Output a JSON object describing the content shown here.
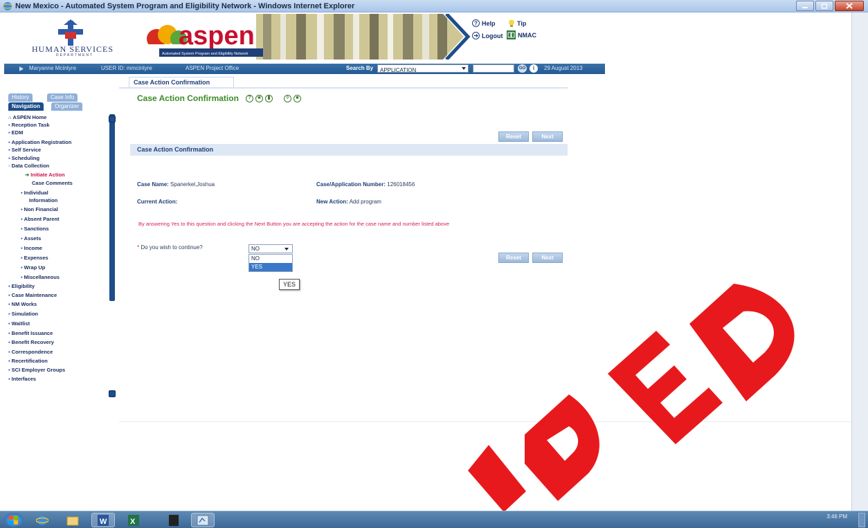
{
  "window": {
    "title": "New Mexico - Automated System Program and Eligibility Network - Windows Internet Explorer"
  },
  "header": {
    "hsd_name": "HUMAN SERVICES",
    "hsd_sub": "DEPARTMENT",
    "app_logo": "aspen",
    "app_tagline": "Automated System Program and Eligibility Network",
    "links": {
      "help": "Help",
      "tip": "Tip",
      "logout": "Logout",
      "nmac": "NMAC"
    }
  },
  "statusbar": {
    "user": "Maryanne Mcintyre",
    "user_id": "USER ID: mmcintyre",
    "office": "ASPEN Project Office",
    "search_label": "Search By",
    "search_value": "APPLICATION",
    "go": "GO",
    "date": "29 August 2013"
  },
  "sidebar": {
    "tabs": [
      "History",
      "Case Info",
      "Navigation",
      "Organizer"
    ],
    "items": [
      {
        "label": "ASPEN Home"
      },
      {
        "label": "Reception Task"
      },
      {
        "label": "EDM"
      },
      {
        "label": "Application Registration"
      },
      {
        "label": "Self Service"
      },
      {
        "label": "Scheduling"
      },
      {
        "label": "Data Collection"
      },
      {
        "label": "Initiate Action"
      },
      {
        "label": "Case Comments"
      },
      {
        "label": "Individual"
      },
      {
        "label": "Information"
      },
      {
        "label": "Non Financial"
      },
      {
        "label": "Absent Parent"
      },
      {
        "label": "Sanctions"
      },
      {
        "label": "Assets"
      },
      {
        "label": "Income"
      },
      {
        "label": "Expenses"
      },
      {
        "label": "Wrap Up"
      },
      {
        "label": "Miscellaneous"
      },
      {
        "label": "Eligibility"
      },
      {
        "label": "Case Maintenance"
      },
      {
        "label": "NM Works"
      },
      {
        "label": "Simulation"
      },
      {
        "label": "Waitlist"
      },
      {
        "label": "Benefit Issuance"
      },
      {
        "label": "Benefit Recovery"
      },
      {
        "label": "Correspondence"
      },
      {
        "label": "Recertification"
      },
      {
        "label": "SCI Employer Groups"
      },
      {
        "label": "Interfaces"
      }
    ]
  },
  "main": {
    "tab": "Case Action Confirmation",
    "title": "Case Action Confirmation",
    "reset": "Reset",
    "next": "Next",
    "section_title": "Case Action Confirmation",
    "case_name_label": "Case Name:",
    "case_name_value": "Spanerkel,Joshua",
    "case_number_label": "Case/Application Number:",
    "case_number_value": "126018456",
    "current_action_label": "Current Action:",
    "new_action_label": "New Action:",
    "new_action_value": "Add program",
    "warning": "By answering Yes to this question and clicking the Next Button  you are accepting the action for the case name and number listed above",
    "question_star": "*",
    "question": "Do you wish to continue?",
    "continue_value": "NO",
    "options": [
      "NO",
      "YES"
    ],
    "tooltip": "YES"
  },
  "stamp": {
    "text": "DED",
    "color": "#e8191c"
  },
  "taskbar": {
    "time": "3:46 PM",
    "date": ""
  }
}
